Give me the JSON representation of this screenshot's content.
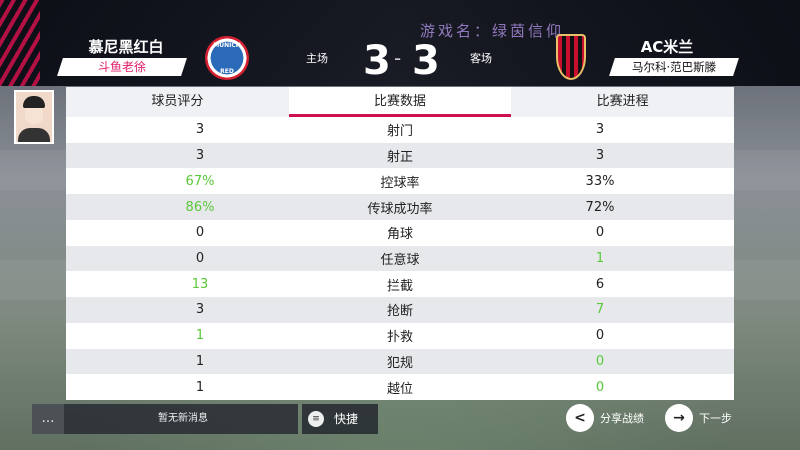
{
  "header": {
    "home_team": "慕尼黑红白",
    "home_manager": "斗鱼老徐",
    "home_crest_text": "MUNICH",
    "home_crest_sub": "RED",
    "home_label": "主场",
    "away_label": "客场",
    "home_score": "3",
    "away_score": "3",
    "away_team": "AC米兰",
    "away_manager": "马尔科·范巴斯滕",
    "watermark": "游戏名：绿茵信仰"
  },
  "tabs": [
    {
      "label": "球员评分",
      "active": false
    },
    {
      "label": "比赛数据",
      "active": true
    },
    {
      "label": "比赛进程",
      "active": false
    }
  ],
  "stats": [
    {
      "label": "射门",
      "home": "3",
      "away": "3",
      "leader": "none"
    },
    {
      "label": "射正",
      "home": "3",
      "away": "3",
      "leader": "none"
    },
    {
      "label": "控球率",
      "home": "67%",
      "away": "33%",
      "leader": "home"
    },
    {
      "label": "传球成功率",
      "home": "86%",
      "away": "72%",
      "leader": "home"
    },
    {
      "label": "角球",
      "home": "0",
      "away": "0",
      "leader": "none"
    },
    {
      "label": "任意球",
      "home": "0",
      "away": "1",
      "leader": "away"
    },
    {
      "label": "拦截",
      "home": "13",
      "away": "6",
      "leader": "home"
    },
    {
      "label": "抢断",
      "home": "3",
      "away": "7",
      "leader": "away"
    },
    {
      "label": "扑救",
      "home": "1",
      "away": "0",
      "leader": "home"
    },
    {
      "label": "犯规",
      "home": "1",
      "away": "0",
      "leader": "away"
    },
    {
      "label": "越位",
      "home": "1",
      "away": "0",
      "leader": "away"
    }
  ],
  "footer": {
    "message": "暂无新消息",
    "quick_label": "快捷",
    "share_label": "分享战绩",
    "next_label": "下一步"
  },
  "colors": {
    "accent": "#d0104c",
    "highlight": "#5ac83a"
  }
}
